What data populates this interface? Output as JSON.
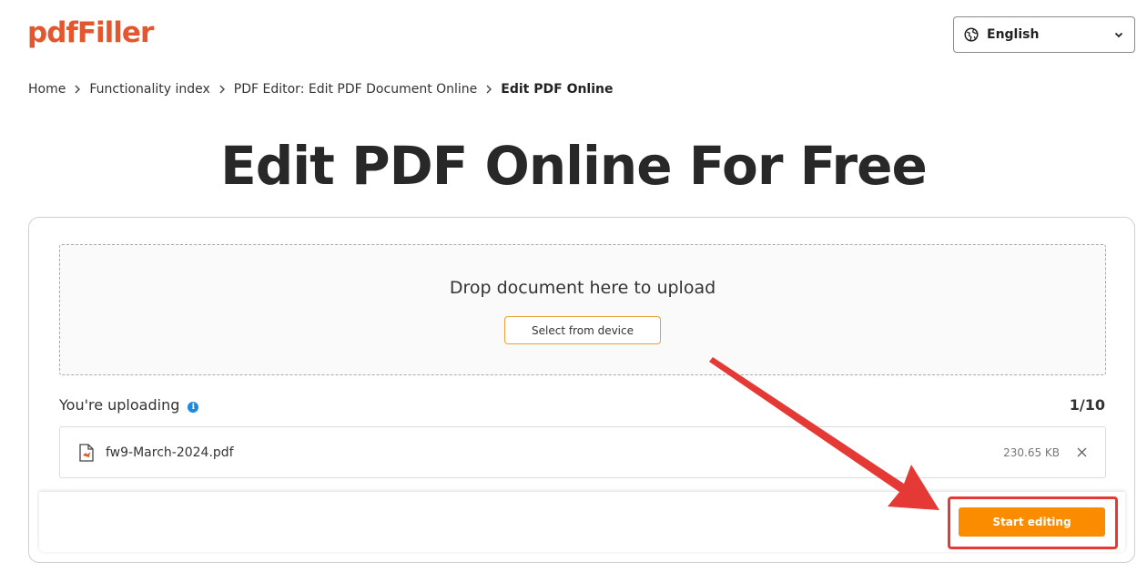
{
  "brand": {
    "logo_text": "pdfFiller",
    "logo_color": "#e4572e"
  },
  "language": {
    "selected": "English",
    "icon": "globe-icon"
  },
  "breadcrumb": {
    "items": [
      "Home",
      "Functionality index",
      "PDF Editor: Edit PDF Document Online"
    ],
    "current": "Edit PDF Online"
  },
  "page": {
    "title": "Edit PDF Online For Free"
  },
  "upload": {
    "drop_title": "Drop document here to upload",
    "select_label": "Select from device",
    "uploading_label": "You're uploading",
    "count": "1/10"
  },
  "files": [
    {
      "name": "fw9-March-2024.pdf",
      "size": "230.65 KB"
    }
  ],
  "actions": {
    "start_label": "Start editing",
    "start_color": "#fb8c00"
  },
  "annotation": {
    "color": "#e53935"
  }
}
